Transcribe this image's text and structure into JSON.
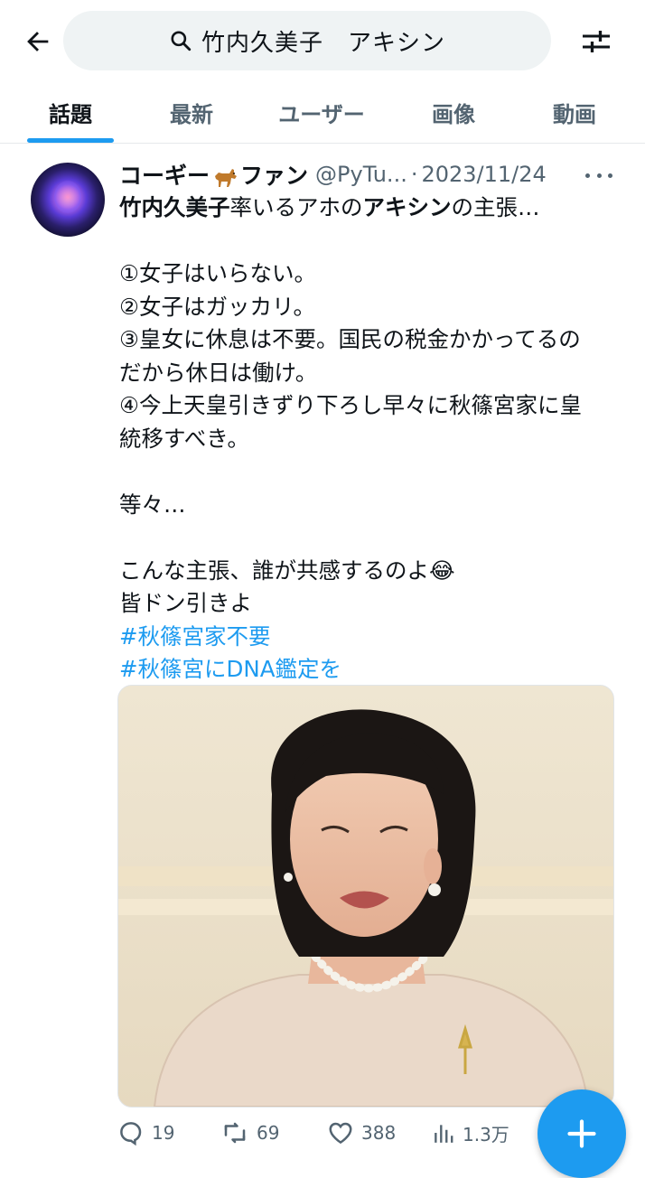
{
  "search": {
    "query": "竹内久美子　アキシン"
  },
  "tabs": [
    {
      "label": "話題",
      "active": true
    },
    {
      "label": "最新",
      "active": false
    },
    {
      "label": "ユーザー",
      "active": false
    },
    {
      "label": "画像",
      "active": false
    },
    {
      "label": "動画",
      "active": false
    }
  ],
  "tweet": {
    "display_name_part1": "コーギー",
    "display_name_emoji": "dog-emoji",
    "display_name_part2": "ファン",
    "handle": "@PyTu...",
    "separator": "·",
    "date": "2023/11/24",
    "line1_bold1": "竹内久美子",
    "line1_mid": "率いるアホの",
    "line1_bold2": "アキシン",
    "line1_end": "の主張…",
    "lines": [
      "①女子はいらない。",
      "②女子はガッカリ。",
      "③皇女に休息は不要。国民の税金かかってるの",
      "だから休日は働け。",
      "④今上天皇引きずり下ろし早々に秋篠宮家に皇",
      "統移すべき。"
    ],
    "etc": "等々…",
    "closing_line1": "こんな主張、誰が共感するのよ😂",
    "closing_line2": "皆ドン引きよ",
    "hashtags": [
      "#秋篠宮家不要",
      "#秋篠宮にDNA鑑定を"
    ],
    "metrics": {
      "replies": "19",
      "retweets": "69",
      "likes": "388",
      "views": "1.3万"
    }
  },
  "colors": {
    "accent": "#1d9bf0",
    "text_primary": "#0f1419",
    "text_secondary": "#536471",
    "search_bg": "#eff3f4"
  },
  "icons": [
    "back-arrow-icon",
    "search-icon",
    "filter-sliders-icon",
    "more-icon",
    "reply-icon",
    "retweet-icon",
    "like-icon",
    "views-icon",
    "compose-plus-icon"
  ]
}
